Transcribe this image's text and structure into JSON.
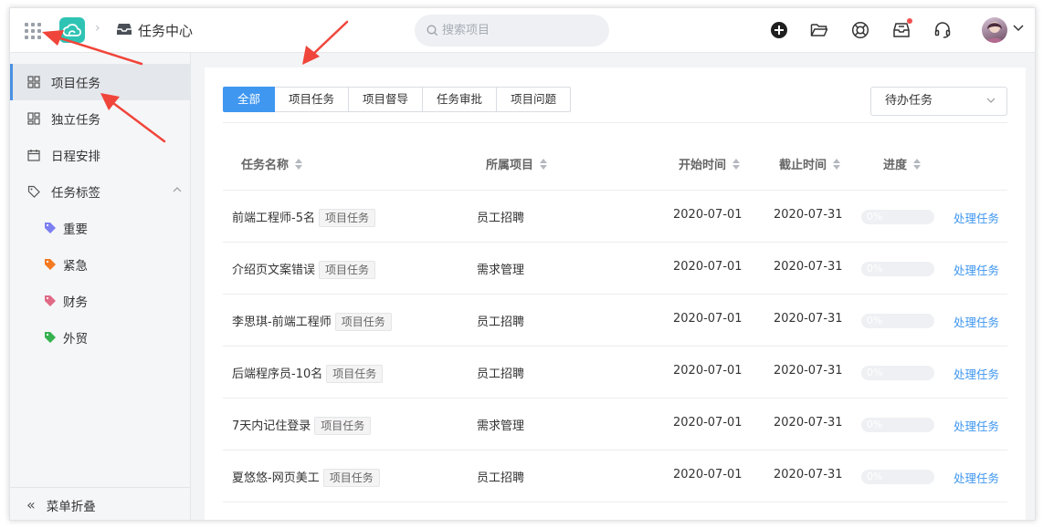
{
  "header": {
    "breadcrumb_title": "任务中心",
    "search_placeholder": "搜索项目"
  },
  "sidebar": {
    "items": [
      {
        "label": "项目任务",
        "icon": "grid-icon",
        "active": true
      },
      {
        "label": "独立任务",
        "icon": "layout-icon",
        "active": false
      },
      {
        "label": "日程安排",
        "icon": "calendar-icon",
        "active": false
      },
      {
        "label": "任务标签",
        "icon": "tag-icon",
        "active": false
      }
    ],
    "tags": [
      {
        "label": "重要",
        "color": "#7b7ff0"
      },
      {
        "label": "紧急",
        "color": "#f37a20"
      },
      {
        "label": "财务",
        "color": "#e06a86"
      },
      {
        "label": "外贸",
        "color": "#35b14f"
      }
    ],
    "collapse_label": "菜单折叠"
  },
  "main": {
    "tabs": [
      "全部",
      "项目任务",
      "项目督导",
      "任务审批",
      "项目问题"
    ],
    "active_tab": "全部",
    "filter_select": "待办任务",
    "columns": {
      "name": "任务名称",
      "project": "所属项目",
      "start": "开始时间",
      "end": "截止时间",
      "progress": "进度"
    },
    "rows": [
      {
        "name": "前端工程师-5名",
        "tag": "项目任务",
        "project": "员工招聘",
        "start": "2020-07-01",
        "end": "2020-07-31",
        "progress": "0%",
        "action": "处理任务"
      },
      {
        "name": "介绍页文案错误",
        "tag": "项目任务",
        "project": "需求管理",
        "start": "2020-07-01",
        "end": "2020-07-31",
        "progress": "0%",
        "action": "处理任务"
      },
      {
        "name": "李思琪-前端工程师",
        "tag": "项目任务",
        "project": "员工招聘",
        "start": "2020-07-01",
        "end": "2020-07-31",
        "progress": "0%",
        "action": "处理任务"
      },
      {
        "name": "后端程序员-10名",
        "tag": "项目任务",
        "project": "员工招聘",
        "start": "2020-07-01",
        "end": "2020-07-31",
        "progress": "0%",
        "action": "处理任务"
      },
      {
        "name": "7天内记住登录",
        "tag": "项目任务",
        "project": "需求管理",
        "start": "2020-07-01",
        "end": "2020-07-31",
        "progress": "0%",
        "action": "处理任务"
      },
      {
        "name": "夏悠悠-网页美工",
        "tag": "项目任务",
        "project": "员工招聘",
        "start": "2020-07-01",
        "end": "2020-07-31",
        "progress": "0%",
        "action": "处理任务"
      }
    ]
  },
  "colors": {
    "accent": "#3f97f0",
    "logo": "#2fc3b4",
    "annotation_arrow": "#f0453a"
  }
}
